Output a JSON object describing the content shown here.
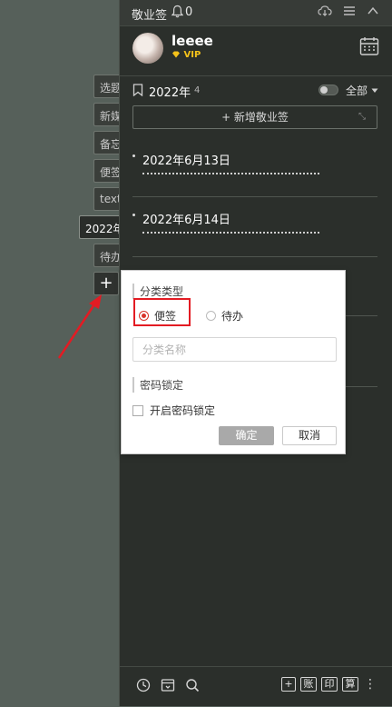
{
  "side_tabs": [
    "选题",
    "新媒",
    "备忘",
    "便签",
    "text",
    "2022年",
    "待办"
  ],
  "side_add_label": "+",
  "titlebar": {
    "title": "敬业签",
    "bell_count": "0"
  },
  "profile": {
    "username": "leeee",
    "vip": "VIP"
  },
  "group": {
    "title": "2022年",
    "count": "4",
    "filter": "全部"
  },
  "add_note_label": "+ 新增敬业签",
  "notes": [
    {
      "date": "2022年6月13日"
    },
    {
      "date": "2022年6月14日"
    }
  ],
  "popup": {
    "category_title": "分类类型",
    "radio_note": "便签",
    "radio_todo": "待办",
    "name_placeholder": "分类名称",
    "lock_title": "密码锁定",
    "lock_checkbox": "开启密码锁定",
    "ok": "确定",
    "cancel": "取消"
  },
  "bottombar": {
    "btn_add": "+",
    "btn_account": "账",
    "btn_print": "印",
    "btn_calc": "算"
  },
  "colors": {
    "accent_red": "#e31b23",
    "panel_bg": "#2b2f2b",
    "vip_gold": "#f4c21a"
  }
}
